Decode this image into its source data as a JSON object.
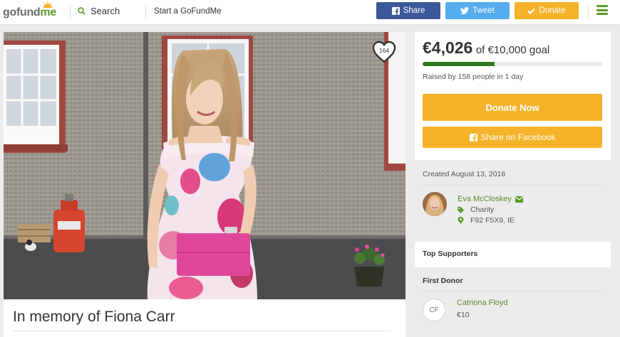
{
  "header": {
    "logo_go": "go",
    "logo_fund": "fund",
    "logo_me": "me",
    "search_label": "Search",
    "start_label": "Start a GoFundMe",
    "share_label": "Share",
    "tweet_label": "Tweet",
    "donate_label": "Donate"
  },
  "campaign": {
    "title": "In memory of Fiona Carr",
    "heart_count": "164"
  },
  "donation": {
    "raised_amount": "€4,026",
    "goal_text": "of €10,000 goal",
    "progress_fraction": 0.4026,
    "raised_by": "Raised by 158 people in 1 day",
    "donate_now_label": "Donate Now",
    "share_facebook_label": "Share on Facebook"
  },
  "info": {
    "created": "Created August 13, 2018",
    "organizer_name": "Eva McCloskey",
    "category": "Charity",
    "location": "F92 F5X9, IE"
  },
  "supporters": {
    "title": "Top Supporters"
  },
  "first_donor": {
    "title": "First Donor",
    "initials": "CF",
    "name": "Catriona Floyd",
    "amount": "€10"
  },
  "colors": {
    "brand_green": "#5e9a28",
    "accent_orange": "#f4b32a",
    "facebook_blue": "#3b5998",
    "twitter_blue": "#55acee",
    "progress_green": "#2d7a1b"
  }
}
